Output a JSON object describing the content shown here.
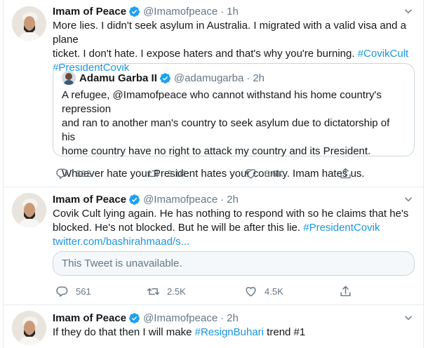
{
  "tweets": [
    {
      "name": "Imam of Peace",
      "handle": "@Imamofpeace",
      "dot": "·",
      "time": "1h",
      "text_lines": [
        "More lies. I didn't seek asylum in Australia. I migrated with a valid visa and a plane",
        "ticket. I don't hate. I expose haters and that's why you're burning."
      ],
      "hashtag_1": "#CovikCult",
      "hashtag_2": "#PresidentCovik",
      "quote": {
        "name": "Adamu Garba II",
        "handle": "@adamugarba",
        "dot": "·",
        "time": "2h",
        "lines": [
          "A refugee, @Imamofpeace who cannot withstand his home country's repression",
          "and ran to another man's country to seek asylum due to dictatorship of his",
          "home country have no right to attack my country and its President.",
          "Whoever hate your President hates your country. Imam hates us."
        ]
      },
      "replies": "662",
      "retweets": "3.1K",
      "likes": "6.6K"
    },
    {
      "name": "Imam of Peace",
      "handle": "@Imamofpeace",
      "dot": "·",
      "time": "2h",
      "text_lines": [
        "Covik Cult lying again. He has nothing to respond with so he claims that he's",
        "blocked. He's not blocked. But he will be after this lie."
      ],
      "hashtag_1": "#PresidentCovik",
      "link": "twitter.com/bashirahmaad/s...",
      "unavailable": "This Tweet is unavailable.",
      "replies": "561",
      "retweets": "2.5K",
      "likes": "4.5K"
    },
    {
      "name": "Imam of Peace",
      "handle": "@Imamofpeace",
      "dot": "·",
      "time": "2h",
      "text_before": "If they do that then I will make ",
      "hashtag_1": "#ResignBuhari",
      "text_after": " trend #1"
    }
  ],
  "colors": {
    "link": "#1b95e0",
    "verified": "#1da1f2",
    "muted": "#657786",
    "border": "#e6ecf0"
  },
  "icons": [
    "verified-icon",
    "chevron-down-icon",
    "reply-icon",
    "retweet-icon",
    "like-icon",
    "share-icon"
  ]
}
